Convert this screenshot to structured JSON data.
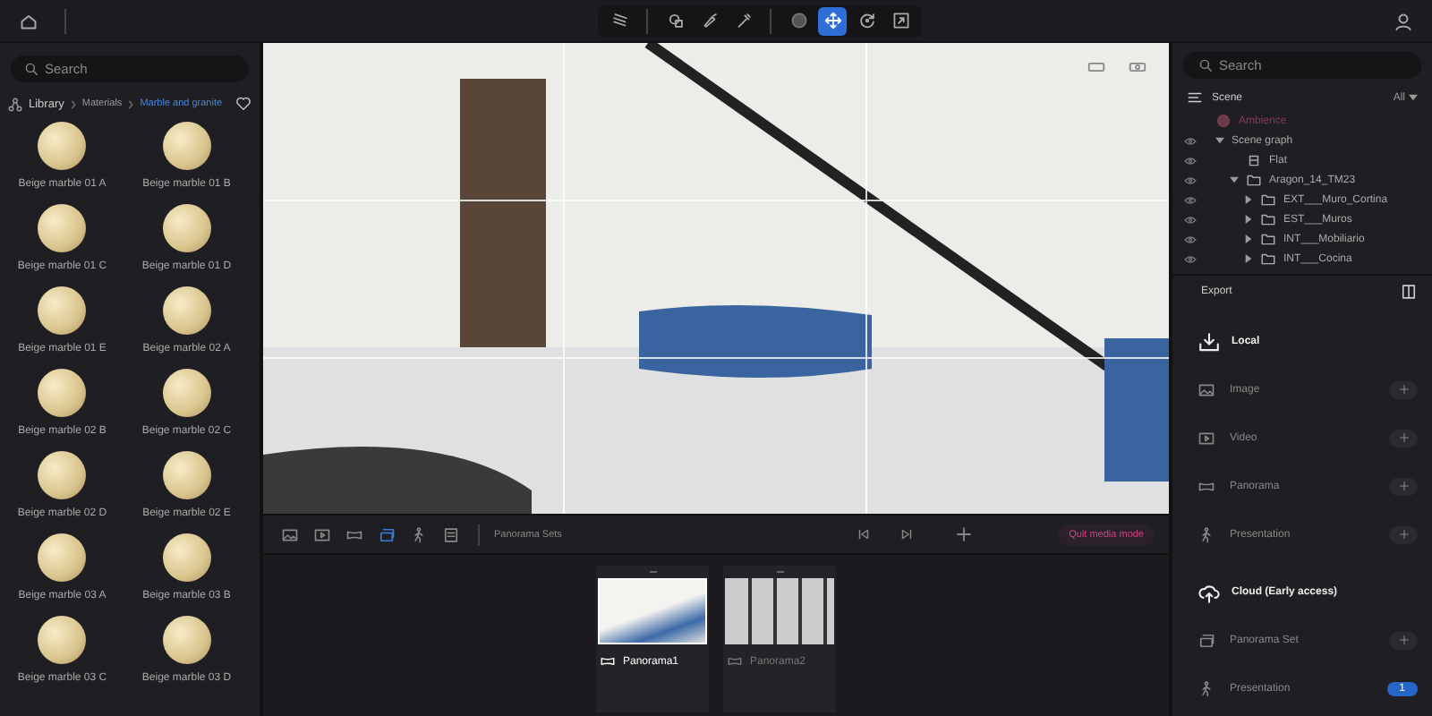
{
  "top_bar": {
    "tools": [
      {
        "kind": "layers",
        "selected": false
      },
      {
        "kind": "shape",
        "selected": false
      },
      {
        "kind": "brush",
        "selected": false
      },
      {
        "kind": "picker",
        "selected": false
      },
      {
        "kind": "sphere",
        "selected": false
      },
      {
        "kind": "move",
        "selected": true
      },
      {
        "kind": "rotate",
        "selected": false
      },
      {
        "kind": "scale",
        "selected": false
      }
    ]
  },
  "library": {
    "search": {
      "placeholder": "Search"
    },
    "breadcrumb": [
      "Library",
      "Materials",
      "Marble and granite"
    ],
    "materials": [
      {
        "name": "Beige marble 01 A"
      },
      {
        "name": "Beige marble 01 B"
      },
      {
        "name": "Beige marble 01 C"
      },
      {
        "name": "Beige marble 01 D"
      },
      {
        "name": "Beige marble 01 E"
      },
      {
        "name": "Beige marble 02 A"
      },
      {
        "name": "Beige marble 02 B"
      },
      {
        "name": "Beige marble 02 C"
      },
      {
        "name": "Beige marble 02 D"
      },
      {
        "name": "Beige marble 02 E"
      },
      {
        "name": "Beige marble 03 A"
      },
      {
        "name": "Beige marble 03 B"
      },
      {
        "name": "Beige marble 03 C"
      },
      {
        "name": "Beige marble 03 D"
      }
    ]
  },
  "media_bar": {
    "tabs": [
      {
        "kind": "image",
        "selected": false
      },
      {
        "kind": "video",
        "selected": false
      },
      {
        "kind": "panorama",
        "selected": false
      },
      {
        "kind": "panorama-set",
        "selected": true
      },
      {
        "kind": "presentation",
        "selected": false
      },
      {
        "kind": "list",
        "selected": false
      }
    ],
    "label": "Panorama Sets",
    "quit_button": "Quit media mode"
  },
  "panoramas": [
    {
      "name": "Panorama1",
      "selected": true
    },
    {
      "name": "Panorama2",
      "selected": false
    }
  ],
  "scene": {
    "search": {
      "placeholder": "Search"
    },
    "title": "Scene",
    "filter": "All",
    "tree": [
      {
        "label": "Ambience",
        "kind": "ambience"
      },
      {
        "label": "Scene graph",
        "kind": "group",
        "expanded": true,
        "children": [
          {
            "label": "Flat",
            "kind": "file"
          },
          {
            "label": "Aragon_14_TM23",
            "kind": "folder",
            "expanded": true,
            "children": [
              {
                "label": "EXT___Muro_Cortina",
                "kind": "folder",
                "expanded": false
              },
              {
                "label": "EST___Muros",
                "kind": "folder",
                "expanded": false
              },
              {
                "label": "INT___Mobiliario",
                "kind": "folder",
                "expanded": false
              },
              {
                "label": "INT___Cocina",
                "kind": "folder",
                "expanded": false
              }
            ]
          }
        ]
      }
    ]
  },
  "export": {
    "title": "Export",
    "sections": [
      {
        "title": "Local",
        "kind": "local",
        "items": [
          {
            "label": "Image",
            "kind": "image"
          },
          {
            "label": "Video",
            "kind": "video"
          },
          {
            "label": "Panorama",
            "kind": "panorama"
          },
          {
            "label": "Presentation",
            "kind": "presentation"
          }
        ]
      },
      {
        "title": "Cloud (Early access)",
        "kind": "cloud",
        "items": [
          {
            "label": "Panorama Set",
            "kind": "panorama-set"
          },
          {
            "label": "Presentation",
            "kind": "presentation",
            "badge": "1"
          }
        ]
      }
    ]
  }
}
